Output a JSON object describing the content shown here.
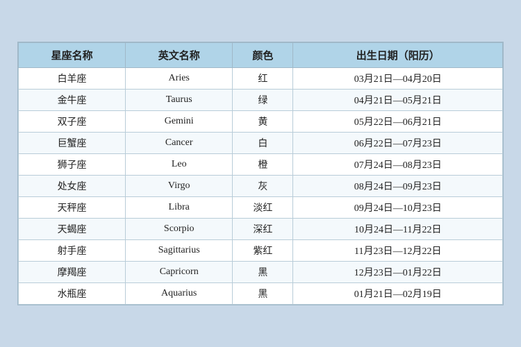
{
  "table": {
    "headers": [
      "星座名称",
      "英文名称",
      "颜色",
      "出生日期（阳历）"
    ],
    "rows": [
      [
        "白羊座",
        "Aries",
        "红",
        "03月21日—04月20日"
      ],
      [
        "金牛座",
        "Taurus",
        "绿",
        "04月21日—05月21日"
      ],
      [
        "双子座",
        "Gemini",
        "黄",
        "05月22日—06月21日"
      ],
      [
        "巨蟹座",
        "Cancer",
        "白",
        "06月22日—07月23日"
      ],
      [
        "狮子座",
        "Leo",
        "橙",
        "07月24日—08月23日"
      ],
      [
        "处女座",
        "Virgo",
        "灰",
        "08月24日—09月23日"
      ],
      [
        "天秤座",
        "Libra",
        "淡红",
        "09月24日—10月23日"
      ],
      [
        "天蝎座",
        "Scorpio",
        "深红",
        "10月24日—11月22日"
      ],
      [
        "射手座",
        "Sagittarius",
        "紫红",
        "11月23日—12月22日"
      ],
      [
        "摩羯座",
        "Capricorn",
        "黑",
        "12月23日—01月22日"
      ],
      [
        "水瓶座",
        "Aquarius",
        "黑",
        "01月21日—02月19日"
      ]
    ]
  }
}
